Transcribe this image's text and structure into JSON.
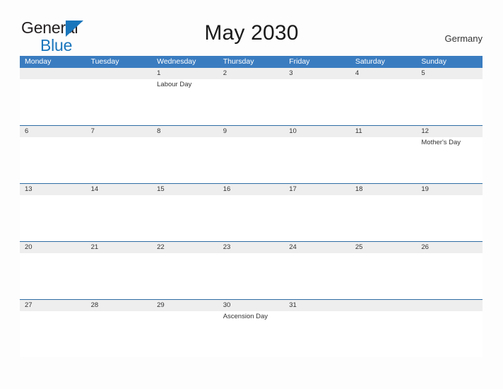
{
  "brand": {
    "word1": "General",
    "word2": "Blue",
    "triangle_color": "#1a76bc",
    "text_color": "#231f20"
  },
  "header": {
    "title": "May 2030",
    "country": "Germany",
    "accent_color": "#3a7cc0",
    "row_border_color": "#2e6da4",
    "date_band_color": "#eeeeee"
  },
  "calendar": {
    "weekdays": [
      "Monday",
      "Tuesday",
      "Wednesday",
      "Thursday",
      "Friday",
      "Saturday",
      "Sunday"
    ],
    "weeks": [
      {
        "days": [
          {
            "num": "",
            "event": ""
          },
          {
            "num": "",
            "event": ""
          },
          {
            "num": "1",
            "event": "Labour Day"
          },
          {
            "num": "2",
            "event": ""
          },
          {
            "num": "3",
            "event": ""
          },
          {
            "num": "4",
            "event": ""
          },
          {
            "num": "5",
            "event": ""
          }
        ]
      },
      {
        "days": [
          {
            "num": "6",
            "event": ""
          },
          {
            "num": "7",
            "event": ""
          },
          {
            "num": "8",
            "event": ""
          },
          {
            "num": "9",
            "event": ""
          },
          {
            "num": "10",
            "event": ""
          },
          {
            "num": "11",
            "event": ""
          },
          {
            "num": "12",
            "event": "Mother's Day"
          }
        ]
      },
      {
        "days": [
          {
            "num": "13",
            "event": ""
          },
          {
            "num": "14",
            "event": ""
          },
          {
            "num": "15",
            "event": ""
          },
          {
            "num": "16",
            "event": ""
          },
          {
            "num": "17",
            "event": ""
          },
          {
            "num": "18",
            "event": ""
          },
          {
            "num": "19",
            "event": ""
          }
        ]
      },
      {
        "days": [
          {
            "num": "20",
            "event": ""
          },
          {
            "num": "21",
            "event": ""
          },
          {
            "num": "22",
            "event": ""
          },
          {
            "num": "23",
            "event": ""
          },
          {
            "num": "24",
            "event": ""
          },
          {
            "num": "25",
            "event": ""
          },
          {
            "num": "26",
            "event": ""
          }
        ]
      },
      {
        "days": [
          {
            "num": "27",
            "event": ""
          },
          {
            "num": "28",
            "event": ""
          },
          {
            "num": "29",
            "event": ""
          },
          {
            "num": "30",
            "event": "Ascension Day"
          },
          {
            "num": "31",
            "event": ""
          },
          {
            "num": "",
            "event": ""
          },
          {
            "num": "",
            "event": ""
          }
        ]
      }
    ]
  }
}
